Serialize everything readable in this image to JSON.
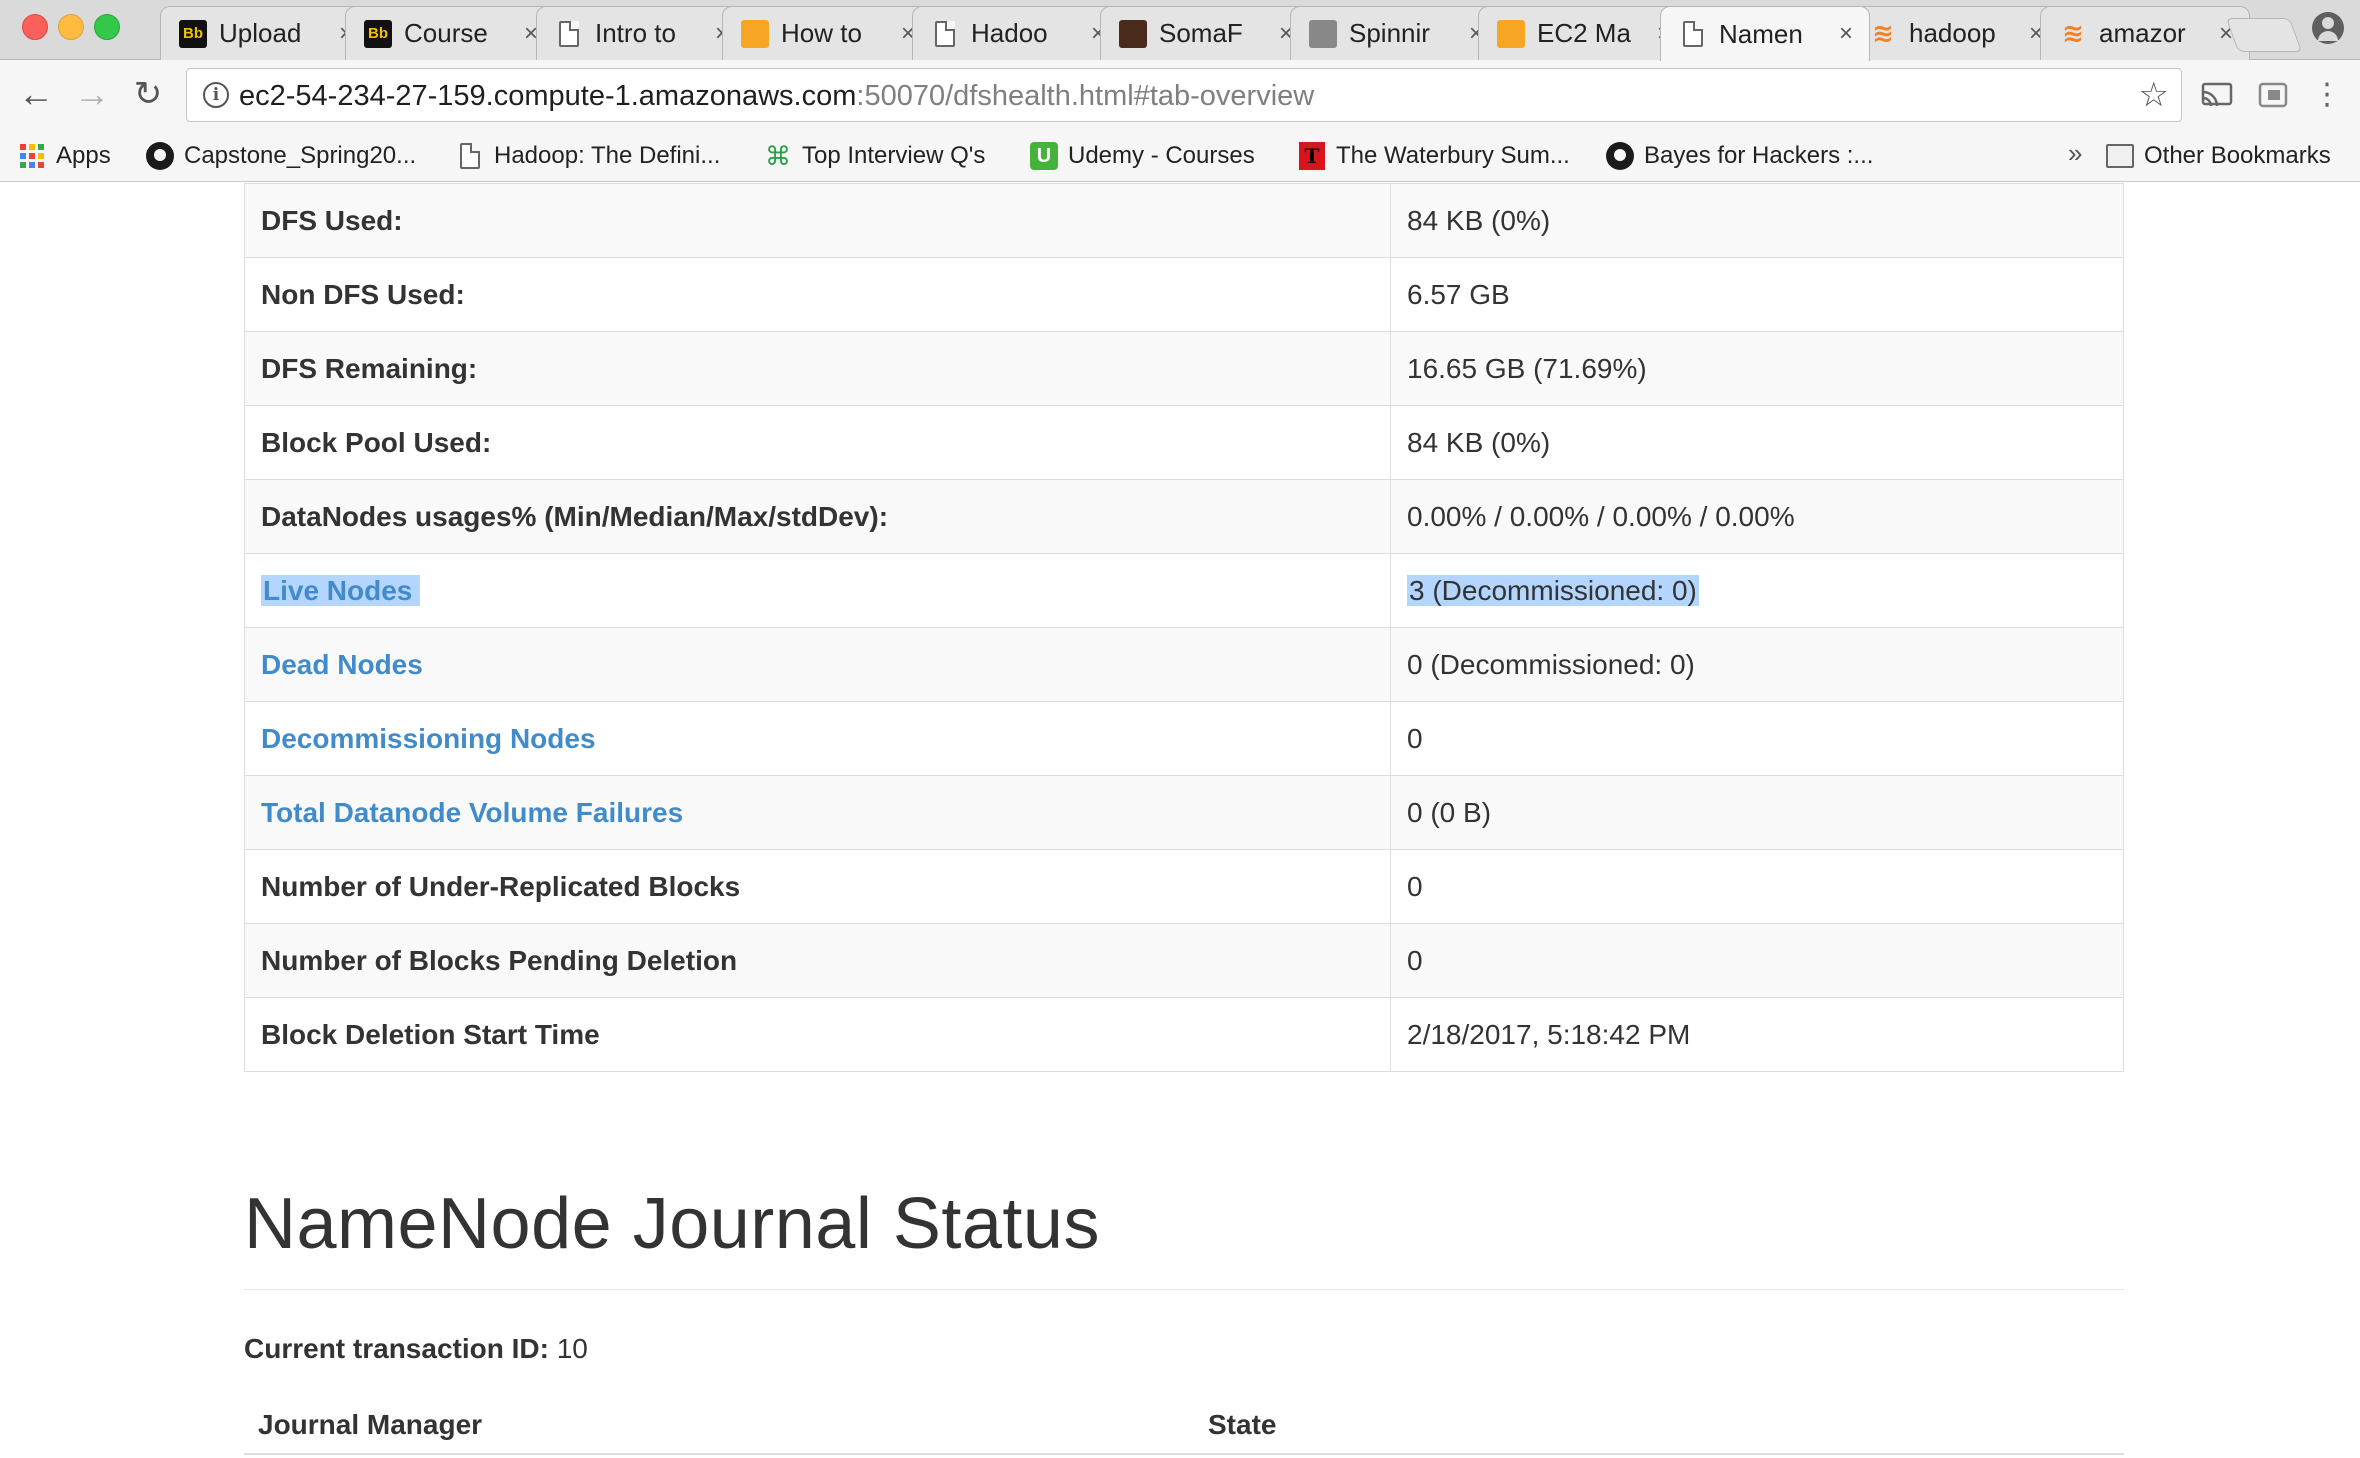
{
  "browser": {
    "tabs": [
      {
        "title": "Upload",
        "favicon": "blackboard-icon"
      },
      {
        "title": "Course",
        "favicon": "blackboard-icon"
      },
      {
        "title": "Intro to",
        "favicon": "document-icon"
      },
      {
        "title": "How to",
        "favicon": "aws-box-icon"
      },
      {
        "title": "Hadoo",
        "favicon": "document-icon"
      },
      {
        "title": "SomaF",
        "favicon": "somafm-icon"
      },
      {
        "title": "Spinnir",
        "favicon": "spinning-icon"
      },
      {
        "title": "EC2 Ma",
        "favicon": "aws-box-icon"
      },
      {
        "title": "Namen",
        "favicon": "document-icon",
        "active": true
      },
      {
        "title": "hadoop",
        "favicon": "stackoverflow-icon"
      },
      {
        "title": "amazor",
        "favicon": "stackoverflow-icon"
      }
    ],
    "address": {
      "host": "ec2-54-234-27-159.compute-1.amazonaws.com",
      "rest": ":50070/dfshealth.html#tab-overview"
    },
    "bookmarks": [
      {
        "label": "Apps",
        "icon": "apps-grid-icon"
      },
      {
        "label": "Capstone_Spring20...",
        "icon": "github-icon"
      },
      {
        "label": "Hadoop: The Defini...",
        "icon": "document-icon"
      },
      {
        "label": "Top Interview Q's",
        "icon": "command-key-icon"
      },
      {
        "label": "Udemy - Courses",
        "icon": "udemy-icon"
      },
      {
        "label": "The Waterbury Sum...",
        "icon": "waterbury-icon"
      },
      {
        "label": "Bayes for Hackers :...",
        "icon": "github-icon"
      }
    ],
    "bookmarks_overflow": "»",
    "other_bookmarks": "Other Bookmarks"
  },
  "summary_rows": [
    {
      "key": "DFS Used:",
      "value": "84 KB (0%)",
      "link": false
    },
    {
      "key": "Non DFS Used:",
      "value": "6.57 GB",
      "link": false
    },
    {
      "key": "DFS Remaining:",
      "value": "16.65 GB (71.69%)",
      "link": false
    },
    {
      "key": "Block Pool Used:",
      "value": "84 KB (0%)",
      "link": false
    },
    {
      "key": "DataNodes usages% (Min/Median/Max/stdDev):",
      "value": "0.00% / 0.00% / 0.00% / 0.00%",
      "link": false
    },
    {
      "key": "Live Nodes",
      "value": "3 (Decommissioned: 0)",
      "link": true,
      "selected": true
    },
    {
      "key": "Dead Nodes",
      "value": "0 (Decommissioned: 0)",
      "link": true
    },
    {
      "key": "Decommissioning Nodes",
      "value": "0",
      "link": true
    },
    {
      "key": "Total Datanode Volume Failures",
      "value": "0 (0 B)",
      "link": true
    },
    {
      "key": "Number of Under-Replicated Blocks",
      "value": "0",
      "link": false
    },
    {
      "key": "Number of Blocks Pending Deletion",
      "value": "0",
      "link": false
    },
    {
      "key": "Block Deletion Start Time",
      "value": "2/18/2017, 5:18:42 PM",
      "link": false
    }
  ],
  "journal": {
    "title": "NameNode Journal Status",
    "txid_label": "Current transaction ID:",
    "txid_value": "10",
    "columns": [
      "Journal Manager",
      "State"
    ]
  },
  "colors": {
    "link": "#428bca",
    "selection": "#b4d5fe",
    "border": "#dddddd"
  }
}
